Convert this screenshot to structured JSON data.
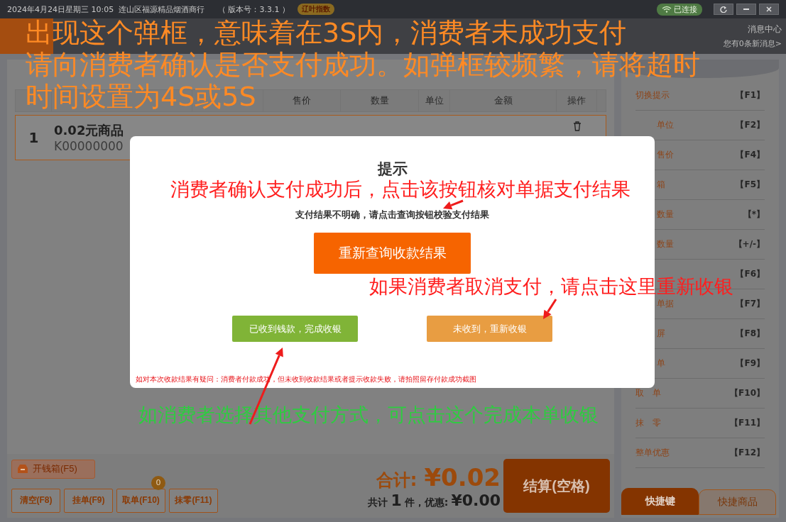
{
  "title_bar": {
    "date_time": "2024年4月24日星期三 10:05",
    "shop_name": "连山区福源精品烟酒商行",
    "version": "（ 版本号：3.3.1 ）",
    "badge": "辽叶指数",
    "connection": "已连接"
  },
  "messages": {
    "title": "消息中心",
    "subtitle": "您有0条新消息>"
  },
  "table": {
    "columns": [
      "售价",
      "数量",
      "单位",
      "金额",
      "操作"
    ],
    "rows": [
      {
        "index": "1",
        "name": "0.02元商品",
        "code": "K00000000"
      }
    ]
  },
  "bottom": {
    "cash_drawer": "开钱箱(F5)",
    "buttons": [
      {
        "label": "清空(F8)"
      },
      {
        "label": "挂单(F9)"
      },
      {
        "label": "取单(F10)",
        "badge": "0"
      },
      {
        "label": "抹零(F11)"
      }
    ],
    "total_label": "合计:",
    "total": "¥0.02",
    "count_prefix": "共计",
    "count": "1",
    "count_suffix": "件，优惠:",
    "discount": "¥0.00",
    "checkout": "结算(空格)"
  },
  "shortcuts": {
    "items": [
      {
        "label": "切换提示",
        "key": "【F1】",
        "kind": "full"
      },
      {
        "label": "单位",
        "key": "【F2】",
        "kind": "partial"
      },
      {
        "label": "售价",
        "key": "【F4】",
        "kind": "partial"
      },
      {
        "label": "箱",
        "key": "【F5】",
        "kind": "partial"
      },
      {
        "label": "数量",
        "key": "【*】",
        "kind": "partial"
      },
      {
        "label": "数量",
        "key": "【+/-】",
        "kind": "partial"
      },
      {
        "key": "【F6】",
        "kind": "hidden"
      },
      {
        "label": "单据",
        "key": "【F7】",
        "kind": "partial"
      },
      {
        "label": "屏",
        "key": "【F8】",
        "kind": "partial"
      },
      {
        "label": "单",
        "key": "【F9】",
        "kind": "partial"
      },
      {
        "label": "取　单",
        "key": "【F10】",
        "kind": "full"
      },
      {
        "label": "抹　零",
        "key": "【F11】",
        "kind": "full"
      },
      {
        "label": "整单优惠",
        "key": "【F12】",
        "kind": "full"
      }
    ],
    "tabs": [
      {
        "label": "快捷键",
        "selected": true
      },
      {
        "label": "快捷商品",
        "selected": false
      }
    ]
  },
  "dialog": {
    "title": "提示",
    "message": "支付结果不明确，请点击查询按钮校验支付结果",
    "primary": "重新查询收款结果",
    "buttons": [
      {
        "label": "已收到钱款，完成收银",
        "kind": "confirm"
      },
      {
        "label": "未收到，重新收银",
        "kind": "retry"
      }
    ],
    "footnote": "如对本次收款结果有疑问：消费者付款成功，但未收到收款结果或者提示收款失败，请拍照留存付款成功截图"
  },
  "annotations": {
    "top_note": [
      "出现这个弹框，意味着在3S内，消费者未成功支付",
      "请向消费者确认是否支付成功。如弹框较频繁，请将超时",
      "时间设置为4S或5S"
    ],
    "callouts": [
      {
        "text": "消费者确认支付成功后，点击该按钮核对单据支付结果",
        "color": "#ff1e1e"
      },
      {
        "text": "如果消费者取消支付，请点击这里重新收银",
        "color": "#ff1e1e"
      },
      {
        "text": "如消费者选择其他支付方式，可点击这个完成本单收银",
        "color": "#2ecc40"
      }
    ]
  }
}
